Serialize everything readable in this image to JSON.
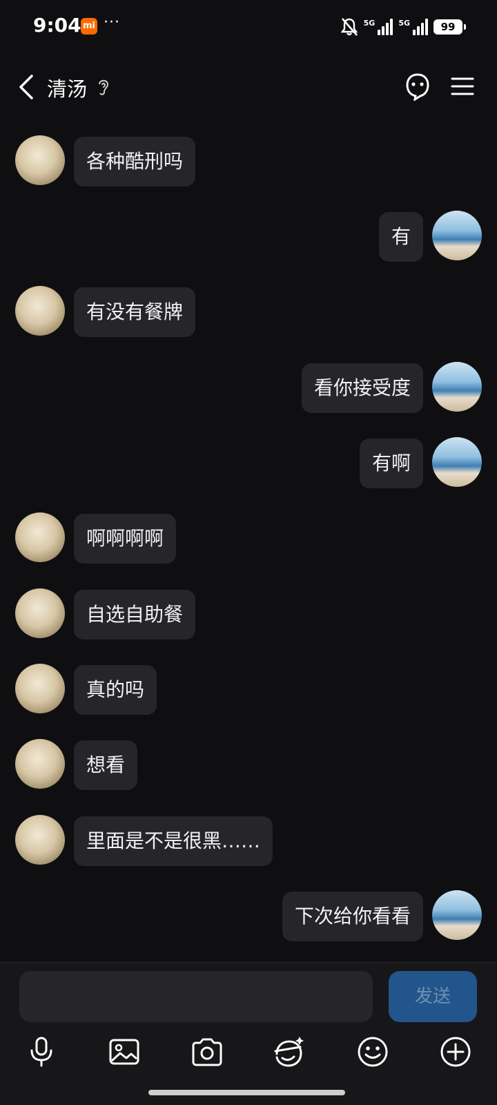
{
  "status_bar": {
    "time": "9:04",
    "mi_badge": "mi",
    "dots": "···",
    "sim1_label": "5G",
    "sim2_label": "5G",
    "battery": "99"
  },
  "header": {
    "title": "清汤",
    "back_icon": "chevron-left-icon",
    "ear_icon": "ear-icon",
    "bot_icon": "bot-face-icon",
    "menu_icon": "menu-icon"
  },
  "messages": [
    {
      "side": "left",
      "text": "各种酷刑吗"
    },
    {
      "side": "right",
      "text": "有"
    },
    {
      "side": "left",
      "text": "有没有餐牌"
    },
    {
      "side": "right",
      "text": "看你接受度"
    },
    {
      "side": "right",
      "text": "有啊"
    },
    {
      "side": "left",
      "text": "啊啊啊啊"
    },
    {
      "side": "left",
      "text": "自选自助餐"
    },
    {
      "side": "left",
      "text": "真的吗"
    },
    {
      "side": "left",
      "text": "想看"
    },
    {
      "side": "left",
      "text": "里面是不是很黑……"
    },
    {
      "side": "right",
      "text": "下次给你看看"
    }
  ],
  "composer": {
    "input_value": "",
    "send_label": "发送"
  },
  "toolbar": [
    "microphone-icon",
    "image-icon",
    "camera-icon",
    "emoji-sticker-icon",
    "smiley-icon",
    "plus-circle-icon"
  ],
  "colors": {
    "background": "#0f0f12",
    "bubble": "#26262a",
    "send_button": "#22558b",
    "send_text": "#6f8fb3"
  }
}
